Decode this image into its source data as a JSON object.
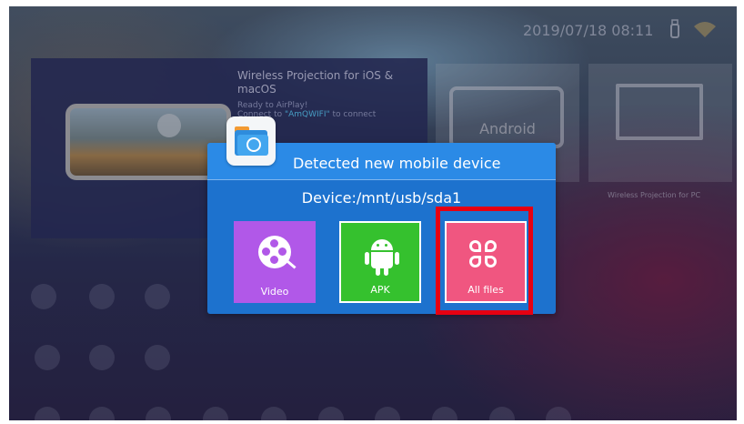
{
  "status_bar": {
    "datetime": "2019/07/18 08:11",
    "usb_icon": "usb-icon",
    "wifi_icon": "wifi-icon"
  },
  "background": {
    "main_card": {
      "title": "Wireless Projection for iOS & macOS",
      "subtitle_line1": "Ready to AirPlay!",
      "subtitle_line2_pre": "Connect to ",
      "subtitle_link": "\"AmQWIFI\"",
      "subtitle_line2_post": " to connect"
    },
    "android_tile": {
      "label": "Android"
    },
    "pc_tile": {
      "caption": "Wireless Projection for PC"
    }
  },
  "dialog": {
    "title": "Detected new mobile device",
    "device_path": "Device:/mnt/usb/sda1",
    "buttons": [
      {
        "label": "Video",
        "icon": "film-reel-icon",
        "color": "#b158e8"
      },
      {
        "label": "APK",
        "icon": "android-icon",
        "color": "#35c12e"
      },
      {
        "label": "All files",
        "icon": "all-files-icon",
        "color": "#f05680"
      }
    ]
  },
  "colors": {
    "dialog_bg": "#1d72ce",
    "highlight": "#e60012"
  }
}
